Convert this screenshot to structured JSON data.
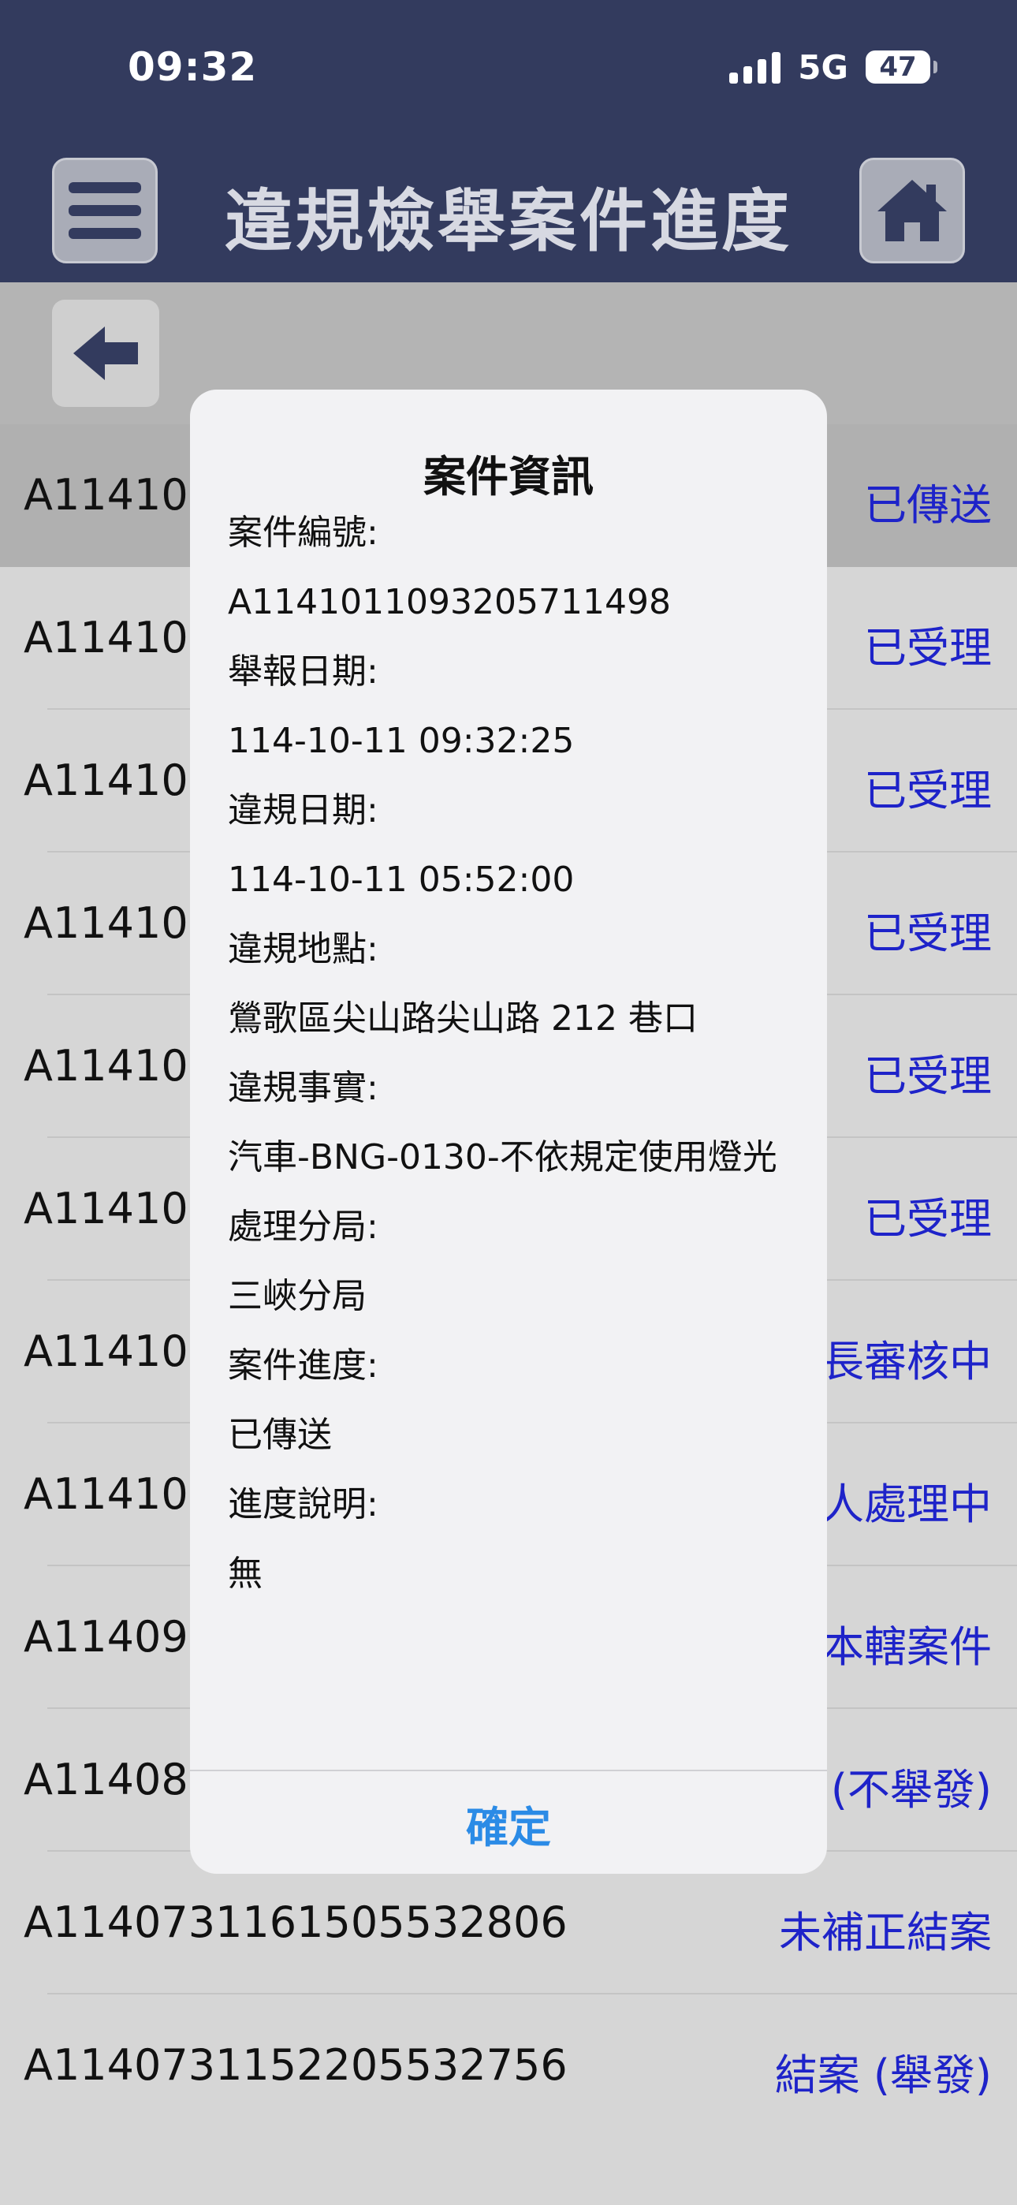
{
  "status_bar": {
    "time": "09:32",
    "network": "5G",
    "battery": "47"
  },
  "header": {
    "title": "違規檢舉案件進度"
  },
  "list": {
    "rows": [
      {
        "id": "A114101",
        "status": "已傳送"
      },
      {
        "id": "A114101",
        "status": "已受理"
      },
      {
        "id": "A114101",
        "status": "已受理"
      },
      {
        "id": "A114101",
        "status": "已受理"
      },
      {
        "id": "A114101",
        "status": "已受理"
      },
      {
        "id": "A114101",
        "status": "已受理"
      },
      {
        "id": "A114100",
        "status": "長審核中"
      },
      {
        "id": "A114100",
        "status": "人處理中"
      },
      {
        "id": "A11409",
        "status": "本轄案件"
      },
      {
        "id": "A11408",
        "status": "(不舉發)"
      },
      {
        "id": "A114073116150553280​6",
        "status": "未補正結案"
      },
      {
        "id": "A114073115220553275​6",
        "status": "結案 (舉發)"
      }
    ]
  },
  "modal": {
    "title": "案件資訊",
    "case_no_label": "案件編號:",
    "case_no": "A114101109320571​1498",
    "report_date_label": "舉報日期:",
    "report_date": "114-10-11 09:32:25",
    "violation_date_label": "違規日期:",
    "violation_date": "114-10-11 05:52:00",
    "location_label": "違規地點:",
    "location": "鶯歌區尖山路尖山路 212 巷口",
    "fact_label": "違規事實:",
    "fact": "汽車-BNG-0130-不依規定使用燈光",
    "branch_label": "處理分局:",
    "branch": "三峽分局",
    "progress_label": "案件進度:",
    "progress": "已傳送",
    "note_label": "進度說明:",
    "note": "無",
    "ok_label": "確定"
  }
}
